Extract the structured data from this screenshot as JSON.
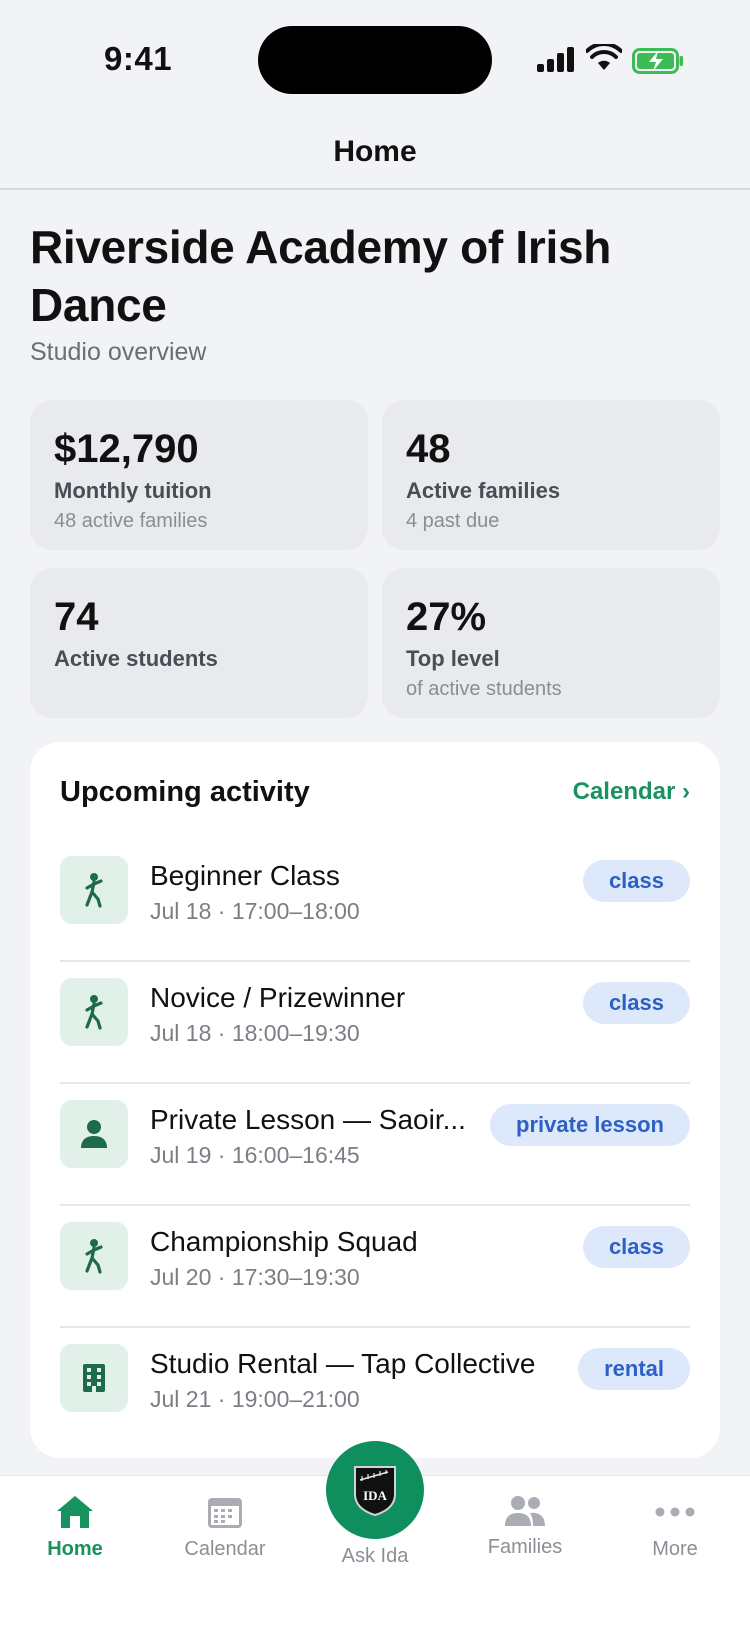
{
  "status_bar": {
    "time": "9:41"
  },
  "nav": {
    "title": "Home"
  },
  "studio": {
    "name": "Riverside Academy of Irish Dance",
    "subtitle": "Studio overview"
  },
  "stats": [
    {
      "value": "$12,790",
      "label": "Monthly tuition",
      "sub": "48 active families"
    },
    {
      "value": "48",
      "label": "Active families",
      "sub": "4 past due"
    },
    {
      "value": "74",
      "label": "Active students",
      "sub": ""
    },
    {
      "value": "27%",
      "label": "Top level",
      "sub": "of active students"
    }
  ],
  "upcoming": {
    "title": "Upcoming activity",
    "link": "Calendar ›",
    "items": [
      {
        "title": "Beginner Class",
        "when": "Jul 18 · 17:00–18:00",
        "tag": "class",
        "icon": "dancer-icon"
      },
      {
        "title": "Novice / Prizewinner",
        "when": "Jul 18 · 18:00–19:30",
        "tag": "class",
        "icon": "dancer-icon"
      },
      {
        "title": "Private Lesson — Saoir...",
        "when": "Jul 19 · 16:00–16:45",
        "tag": "private lesson",
        "icon": "person-icon"
      },
      {
        "title": "Championship Squad",
        "when": "Jul 20 · 17:30–19:30",
        "tag": "class",
        "icon": "dancer-icon"
      },
      {
        "title": "Studio Rental — Tap Collective",
        "when": "Jul 21 · 19:00–21:00",
        "tag": "rental",
        "icon": "building-icon"
      }
    ]
  },
  "tabs": [
    {
      "label": "Home",
      "icon": "home-icon",
      "active": true
    },
    {
      "label": "Calendar",
      "icon": "calendar-icon",
      "active": false
    },
    {
      "label": "Ask Ida",
      "icon": "ida-logo-icon",
      "active": false
    },
    {
      "label": "Families",
      "icon": "people-icon",
      "active": false
    },
    {
      "label": "More",
      "icon": "more-icon",
      "active": false
    }
  ],
  "colors": {
    "accent": "#18925e",
    "tag_bg": "#dde9fb",
    "tag_text": "#2d5fc4",
    "icon_bg": "#e1f1e9"
  }
}
